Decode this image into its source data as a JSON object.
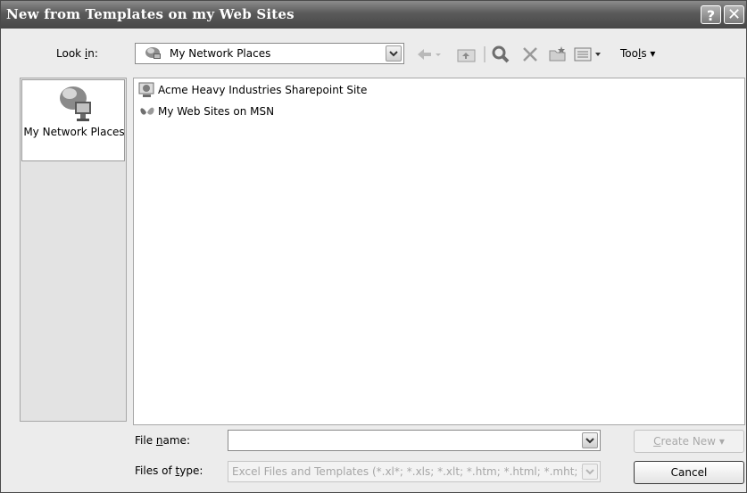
{
  "window": {
    "title": "New from Templates on my Web Sites",
    "help_glyph": "?",
    "close_glyph": "✕"
  },
  "toolbar": {
    "lookin_label_pre": "Look ",
    "lookin_label_key": "i",
    "lookin_label_post": "n:",
    "lookin_value": "My Network Places",
    "tools_label_pre": "Too",
    "tools_label_key": "l",
    "tools_label_post": "s",
    "tools_arrow": "▾",
    "icons": [
      "back-arrow-icon",
      "up-one-level-icon",
      "search-web-icon",
      "delete-icon",
      "new-folder-icon",
      "views-icon"
    ]
  },
  "places_bar": {
    "items": [
      {
        "label": "My Network Places",
        "icon": "network-places-icon"
      }
    ]
  },
  "file_list": {
    "items": [
      {
        "name": "Acme Heavy Industries Sharepoint Site",
        "icon": "sharepoint-site-icon"
      },
      {
        "name": "My Web Sites on MSN",
        "icon": "msn-butterfly-icon"
      }
    ]
  },
  "form": {
    "file_name_label_pre": "File ",
    "file_name_label_key": "n",
    "file_name_label_post": "ame:",
    "file_name_value": "",
    "file_type_label_pre": "Files of ",
    "file_type_label_key": "t",
    "file_type_label_post": "ype:",
    "file_type_value": "Excel Files and Templates (*.xl*; *.xls; *.xlt; *.htm; *.html; *.mht; *.mhtml; *.xml)"
  },
  "buttons": {
    "create_key": "C",
    "create_rest": "reate New",
    "create_arrow": "▾",
    "cancel": "Cancel"
  }
}
